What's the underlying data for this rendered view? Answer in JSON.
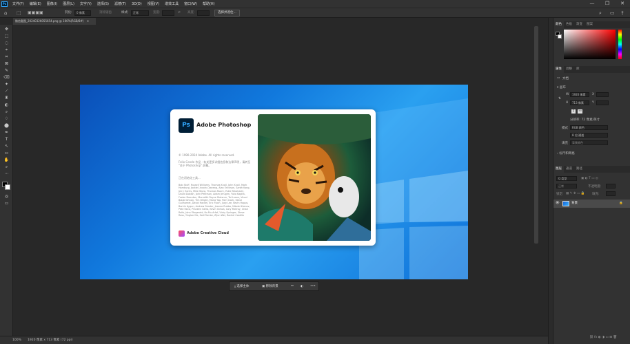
{
  "menubar": {
    "app_icon": "Ps",
    "items": [
      "文件(F)",
      "编辑(E)",
      "图像(I)",
      "图层(L)",
      "文字(Y)",
      "选择(S)",
      "滤镜(T)",
      "3D(D)",
      "视图(V)",
      "增效工具",
      "窗口(W)",
      "帮助(H)"
    ],
    "window_controls": [
      "—",
      "❐",
      "✕"
    ]
  },
  "options": {
    "feather_label": "羽化:",
    "feather_value": "0 像素",
    "antialias_label": "消除锯齿",
    "style_label": "样式:",
    "style_value": "正常",
    "width_label": "宽度:",
    "height_label": "高度:",
    "select_mask_button": "选择并遮住..."
  },
  "tab": {
    "title": "微信截图_20240326055654.png @ 100%(RGB/8#)"
  },
  "tools": [
    "✥",
    "⬚",
    "◌",
    "⌖",
    "⌗",
    "⊠",
    "✎",
    "⌫",
    "✦",
    "⟋",
    "♜",
    "◐",
    "⌕",
    "♢",
    "⬤",
    "T",
    "↖",
    "▭",
    "✋",
    "⌕"
  ],
  "splash": {
    "ps_icon": "Ps",
    "title": "Adobe Photoshop",
    "copyright": "© 1990-2024 Adobe. All rights reserved.",
    "credit": "Felix Conde 作品 · 有关更多详细信息和法律声明，请转至 \"关于 Photoshop\" 屏幕。",
    "loading": "正在初始化工具...",
    "names": "Bob Stuff, Russell Williams, Thomas Knoll, John Knoll, Mark Hamburg, Jackie Lincoln-Owyang, Alan Erickson, Sarah Kong, Jerry Harris, Mike Shaw, Thomas Ruark, Yukie Takahashi, David Dobish, John Peterson, Adam Jerugim, Yuko Kagita, Foster Brereton, Meredith Payne Stotzner, Tai Luxon, Vinod Balakrishnan, Tim Wright, Maria Yap, Pam Clark, Steve Guilhamet, David Hackel, Eric Floch, Judy Lee, Kevin Hopps, Barkin Aygun, Andrew Sender, Jeanne Rubbo, Nikolai Krenov, Pete Falco, Praveen Gelra, Kevin Ochoa, Cory McIlroy, Chad Rolfs, John Fitzgerald, Ko-Mu Arfaf, Vicky Springer, Steve Ross, Yinglan Ma, Salil Tambe, Zijun Wei, Rachel Castillo",
    "cc_label": "Adobe Creative Cloud"
  },
  "ctxbar": {
    "select_subject": "选择主体",
    "remove_bg": "移除背景",
    "icons": [
      "⚯",
      "◐",
      "•••"
    ]
  },
  "statusbar": {
    "zoom": "100%",
    "info": "1920 像素 x 713 像素 (72 ppi)"
  },
  "panels": {
    "color_tabs": [
      "颜色",
      "色板",
      "渐变",
      "图案"
    ],
    "props_tabs": [
      "属性",
      "调整",
      "库"
    ],
    "doc_label": "文档",
    "canvas_section": "画布",
    "w_label": "W",
    "w_value": "1920 像素",
    "h_label": "H",
    "h_value": "713 像素",
    "x_label": "X",
    "y_label": "Y",
    "resolution": "分辨率: 72 像素/英寸",
    "mode_label": "模式",
    "mode_value": "RGB 颜色",
    "depth_value": "8 位/通道",
    "fill_label": "填充",
    "fill_value": "背景颜色",
    "rulers_section": "标尺和网格",
    "layers_tabs": [
      "图层",
      "通道",
      "路径"
    ],
    "kind_label": "Q 类型",
    "normal_label": "正常",
    "opacity_label": "不透明度:",
    "lock_label": "锁定:",
    "fill2_label": "填充:",
    "layer_name": "背景"
  },
  "colors": {
    "accent": "#31a8ff",
    "ps_dark": "#001e36",
    "chrome": "#323232",
    "canvas_bg": "#282828"
  }
}
